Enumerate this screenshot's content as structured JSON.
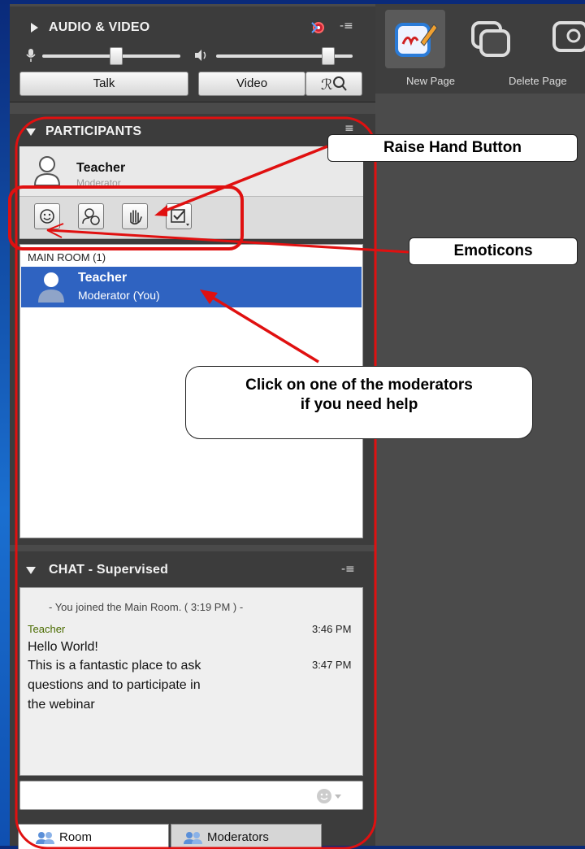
{
  "audio_video": {
    "title": "AUDIO & VIDEO",
    "talk_label": "Talk",
    "video_label": "Video",
    "mic_slider_level": 0.45,
    "speaker_slider_level": 0.85
  },
  "participants": {
    "title": "PARTICIPANTS",
    "current_user": {
      "name": "Teacher",
      "role": "Moderator"
    },
    "room_label": "MAIN ROOM (1)",
    "list": [
      {
        "name": "Teacher",
        "role": "Moderator (You)",
        "selected": true
      }
    ]
  },
  "chat": {
    "title": "CHAT - Supervised",
    "system_message": "- You joined the Main Room. ( 3:19 PM ) -",
    "messages": [
      {
        "sender": "Teacher",
        "time": "3:46 PM",
        "text": "Hello World!"
      },
      {
        "sender": "",
        "time": "3:47 PM",
        "text_lines": [
          "This is a fantastic place to ask",
          "questions and to participate in",
          "the webinar"
        ]
      }
    ],
    "tabs": [
      "Room",
      "Moderators"
    ]
  },
  "whiteboard_toolbar": {
    "items": [
      "New Page",
      "Delete Page"
    ]
  },
  "callouts": {
    "raise_hand": "Raise Hand Button",
    "emoticons": "Emoticons",
    "moderators_help_line1": "Click on one of the moderators",
    "moderators_help_line2": "if you need help"
  },
  "colors": {
    "frame_blue": "#0b2f8c",
    "selected_row": "#2f63c1",
    "annotation_red": "#e01010",
    "chat_sender": "#4a6b00"
  }
}
